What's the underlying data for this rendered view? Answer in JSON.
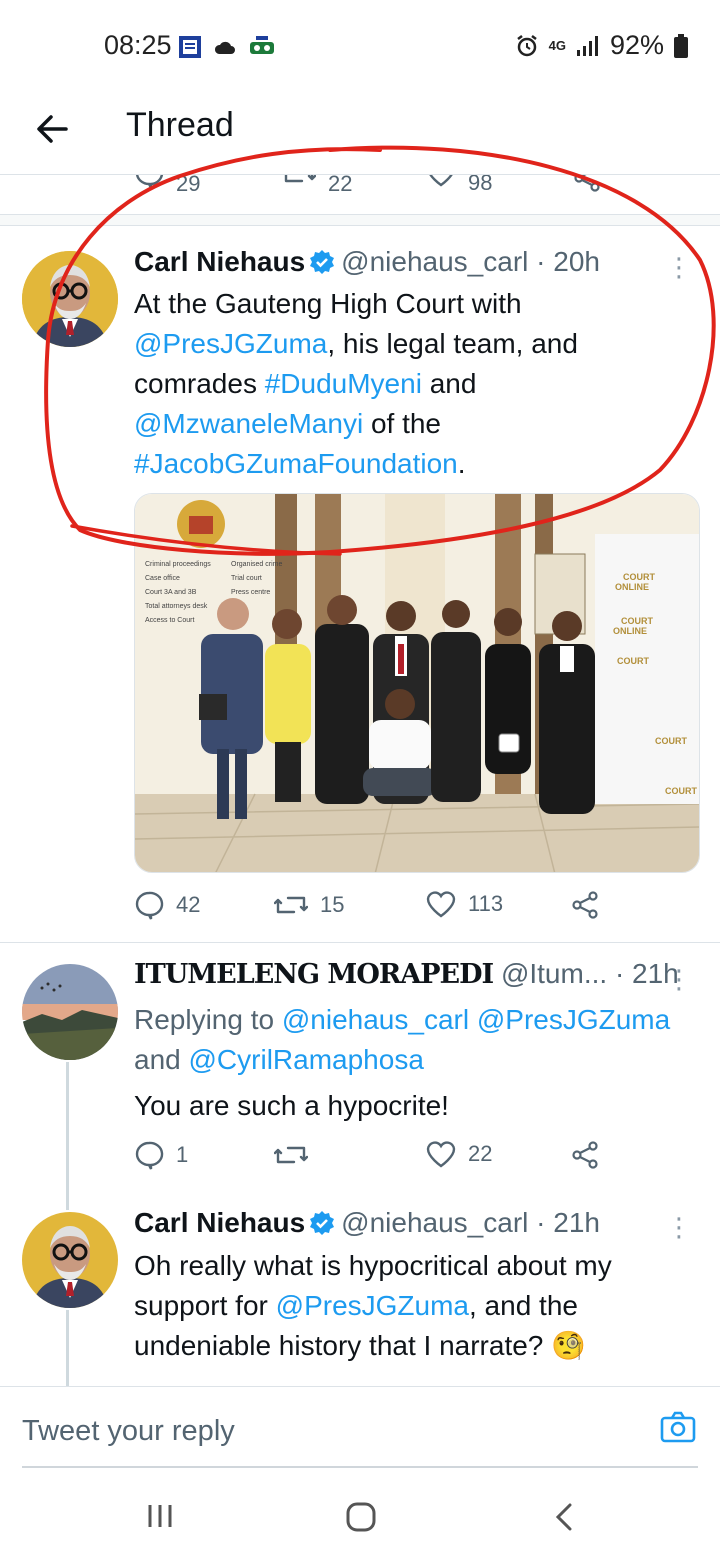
{
  "status_bar": {
    "time": "08:25",
    "network": "4G",
    "battery": "92%"
  },
  "header": {
    "title": "Thread"
  },
  "previous_tweet": {
    "replies": "29",
    "retweets": "22",
    "likes": "98"
  },
  "main_tweet": {
    "name": "Carl Niehaus",
    "handle": "@niehaus_carl",
    "time": "· 20h",
    "text_1": "At the Gauteng High Court with",
    "mention_1": "@PresJGZuma",
    "text_2": ", his legal team, and",
    "text_3": "comrades ",
    "hashtag_1": "#DuduMyeni",
    "text_4": " and",
    "mention_2": "@MzwaneleManyi",
    "text_5": " of the",
    "hashtag_2": "#JacobGZumaFoundation",
    "text_6": ".",
    "replies": "42",
    "retweets": "15",
    "likes": "113"
  },
  "reply_1": {
    "name": "ITUMELENG MORAPEDI",
    "handle": "@Itum...",
    "time": "· 21h",
    "replying_prefix": "Replying to ",
    "replying_users": "@niehaus_carl @PresJGZuma",
    "replying_and": "and ",
    "replying_user_3": "@CyrilRamaphosa",
    "text": "You are such a hypocrite!",
    "replies": "1",
    "retweets": "",
    "likes": "22"
  },
  "reply_2": {
    "name": "Carl Niehaus",
    "handle": "@niehaus_carl",
    "time": "· 21h",
    "text_1": "Oh really what is hypocritical about my",
    "text_2": "support for ",
    "mention": "@PresJGZuma",
    "text_3": ", and the",
    "text_4": "undeniable history that I narrate?",
    "emoji": "🧐"
  },
  "reply_bar": {
    "placeholder": "Tweet your reply"
  },
  "photo_signs": {
    "court": "COURT",
    "online": "ONLINE"
  },
  "colors": {
    "link": "#1d9bf0",
    "annotation": "#e0241b",
    "verified": "#1d9bf0"
  }
}
